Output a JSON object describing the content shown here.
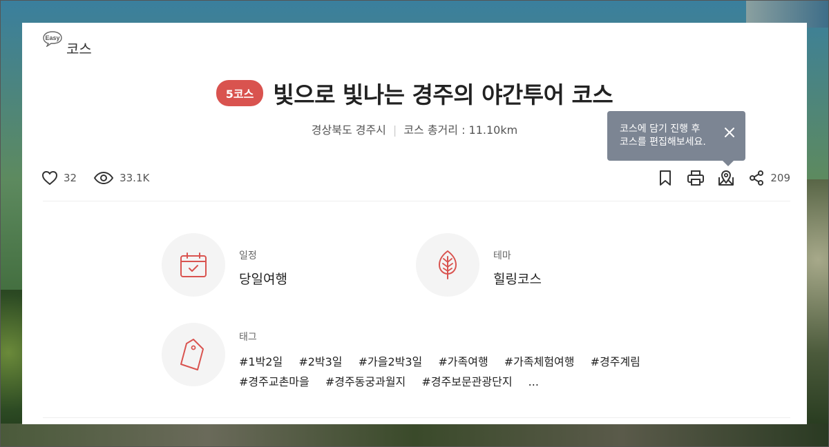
{
  "header": {
    "easy_logo_text": "Easy",
    "section_label": "코스",
    "course_badge": "5코스",
    "title": "빛으로 빛나는 경주의 야간투어 코스"
  },
  "meta": {
    "region": "경상북도 경주시",
    "separator": "|",
    "distance": "코스 총거리 : 11.10km"
  },
  "tooltip": {
    "line1": "코스에 담기 진행 후",
    "line2": "코스를 편집해보세요."
  },
  "stats": {
    "likes": "32",
    "views": "33.1K"
  },
  "actions": {
    "share_count": "209"
  },
  "info": {
    "schedule": {
      "label": "일정",
      "value": "당일여행"
    },
    "theme": {
      "label": "테마",
      "value": "힐링코스"
    },
    "tags": {
      "label": "태그",
      "items": [
        "#1박2일",
        "#2박3일",
        "#가을2박3일",
        "#가족여행",
        "#가족체험여행",
        "#경주계림",
        "#경주교촌마을",
        "#경주동궁과월지",
        "#경주보문관광단지",
        "..."
      ]
    }
  },
  "colors": {
    "accent": "#d9534f",
    "tooltip_bg": "#7c8593",
    "circle_bg": "#f4f4f4"
  }
}
